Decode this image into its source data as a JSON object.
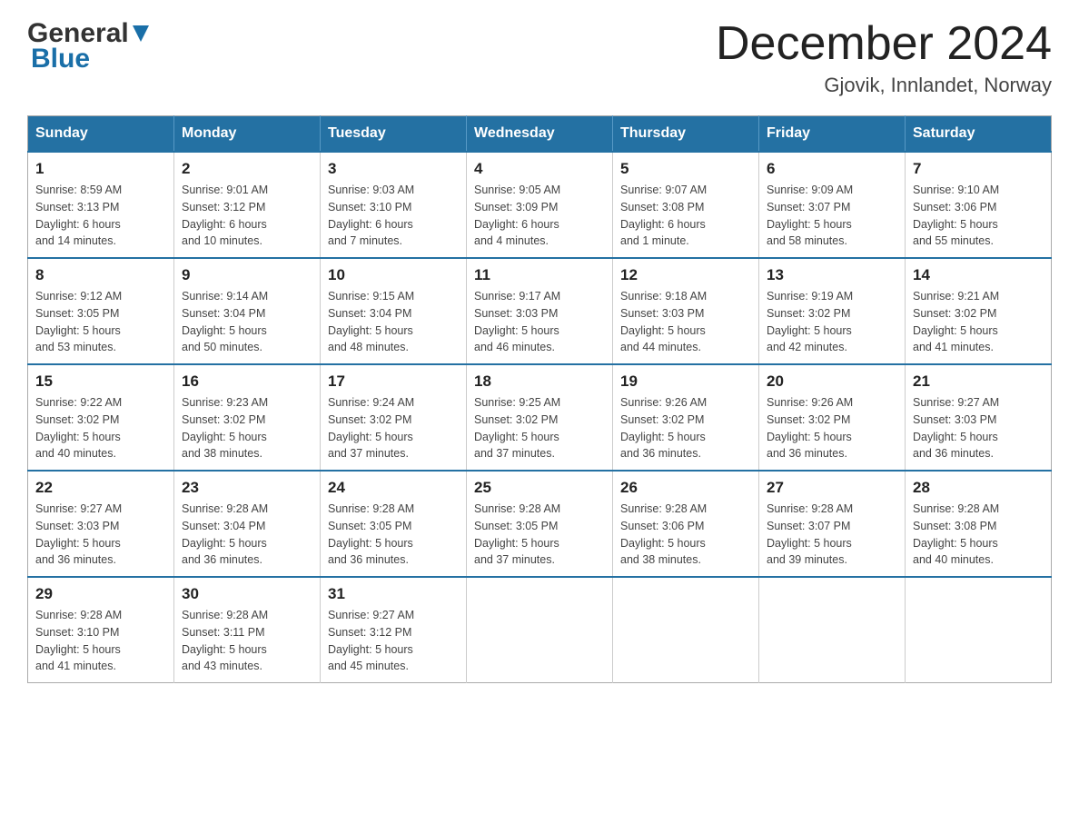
{
  "header": {
    "logo_text_general": "General",
    "logo_text_blue": "Blue",
    "month_title": "December 2024",
    "location": "Gjovik, Innlandet, Norway"
  },
  "days_of_week": [
    "Sunday",
    "Monday",
    "Tuesday",
    "Wednesday",
    "Thursday",
    "Friday",
    "Saturday"
  ],
  "weeks": [
    [
      {
        "day": "1",
        "info": "Sunrise: 8:59 AM\nSunset: 3:13 PM\nDaylight: 6 hours\nand 14 minutes."
      },
      {
        "day": "2",
        "info": "Sunrise: 9:01 AM\nSunset: 3:12 PM\nDaylight: 6 hours\nand 10 minutes."
      },
      {
        "day": "3",
        "info": "Sunrise: 9:03 AM\nSunset: 3:10 PM\nDaylight: 6 hours\nand 7 minutes."
      },
      {
        "day": "4",
        "info": "Sunrise: 9:05 AM\nSunset: 3:09 PM\nDaylight: 6 hours\nand 4 minutes."
      },
      {
        "day": "5",
        "info": "Sunrise: 9:07 AM\nSunset: 3:08 PM\nDaylight: 6 hours\nand 1 minute."
      },
      {
        "day": "6",
        "info": "Sunrise: 9:09 AM\nSunset: 3:07 PM\nDaylight: 5 hours\nand 58 minutes."
      },
      {
        "day": "7",
        "info": "Sunrise: 9:10 AM\nSunset: 3:06 PM\nDaylight: 5 hours\nand 55 minutes."
      }
    ],
    [
      {
        "day": "8",
        "info": "Sunrise: 9:12 AM\nSunset: 3:05 PM\nDaylight: 5 hours\nand 53 minutes."
      },
      {
        "day": "9",
        "info": "Sunrise: 9:14 AM\nSunset: 3:04 PM\nDaylight: 5 hours\nand 50 minutes."
      },
      {
        "day": "10",
        "info": "Sunrise: 9:15 AM\nSunset: 3:04 PM\nDaylight: 5 hours\nand 48 minutes."
      },
      {
        "day": "11",
        "info": "Sunrise: 9:17 AM\nSunset: 3:03 PM\nDaylight: 5 hours\nand 46 minutes."
      },
      {
        "day": "12",
        "info": "Sunrise: 9:18 AM\nSunset: 3:03 PM\nDaylight: 5 hours\nand 44 minutes."
      },
      {
        "day": "13",
        "info": "Sunrise: 9:19 AM\nSunset: 3:02 PM\nDaylight: 5 hours\nand 42 minutes."
      },
      {
        "day": "14",
        "info": "Sunrise: 9:21 AM\nSunset: 3:02 PM\nDaylight: 5 hours\nand 41 minutes."
      }
    ],
    [
      {
        "day": "15",
        "info": "Sunrise: 9:22 AM\nSunset: 3:02 PM\nDaylight: 5 hours\nand 40 minutes."
      },
      {
        "day": "16",
        "info": "Sunrise: 9:23 AM\nSunset: 3:02 PM\nDaylight: 5 hours\nand 38 minutes."
      },
      {
        "day": "17",
        "info": "Sunrise: 9:24 AM\nSunset: 3:02 PM\nDaylight: 5 hours\nand 37 minutes."
      },
      {
        "day": "18",
        "info": "Sunrise: 9:25 AM\nSunset: 3:02 PM\nDaylight: 5 hours\nand 37 minutes."
      },
      {
        "day": "19",
        "info": "Sunrise: 9:26 AM\nSunset: 3:02 PM\nDaylight: 5 hours\nand 36 minutes."
      },
      {
        "day": "20",
        "info": "Sunrise: 9:26 AM\nSunset: 3:02 PM\nDaylight: 5 hours\nand 36 minutes."
      },
      {
        "day": "21",
        "info": "Sunrise: 9:27 AM\nSunset: 3:03 PM\nDaylight: 5 hours\nand 36 minutes."
      }
    ],
    [
      {
        "day": "22",
        "info": "Sunrise: 9:27 AM\nSunset: 3:03 PM\nDaylight: 5 hours\nand 36 minutes."
      },
      {
        "day": "23",
        "info": "Sunrise: 9:28 AM\nSunset: 3:04 PM\nDaylight: 5 hours\nand 36 minutes."
      },
      {
        "day": "24",
        "info": "Sunrise: 9:28 AM\nSunset: 3:05 PM\nDaylight: 5 hours\nand 36 minutes."
      },
      {
        "day": "25",
        "info": "Sunrise: 9:28 AM\nSunset: 3:05 PM\nDaylight: 5 hours\nand 37 minutes."
      },
      {
        "day": "26",
        "info": "Sunrise: 9:28 AM\nSunset: 3:06 PM\nDaylight: 5 hours\nand 38 minutes."
      },
      {
        "day": "27",
        "info": "Sunrise: 9:28 AM\nSunset: 3:07 PM\nDaylight: 5 hours\nand 39 minutes."
      },
      {
        "day": "28",
        "info": "Sunrise: 9:28 AM\nSunset: 3:08 PM\nDaylight: 5 hours\nand 40 minutes."
      }
    ],
    [
      {
        "day": "29",
        "info": "Sunrise: 9:28 AM\nSunset: 3:10 PM\nDaylight: 5 hours\nand 41 minutes."
      },
      {
        "day": "30",
        "info": "Sunrise: 9:28 AM\nSunset: 3:11 PM\nDaylight: 5 hours\nand 43 minutes."
      },
      {
        "day": "31",
        "info": "Sunrise: 9:27 AM\nSunset: 3:12 PM\nDaylight: 5 hours\nand 45 minutes."
      },
      {
        "day": "",
        "info": ""
      },
      {
        "day": "",
        "info": ""
      },
      {
        "day": "",
        "info": ""
      },
      {
        "day": "",
        "info": ""
      }
    ]
  ]
}
